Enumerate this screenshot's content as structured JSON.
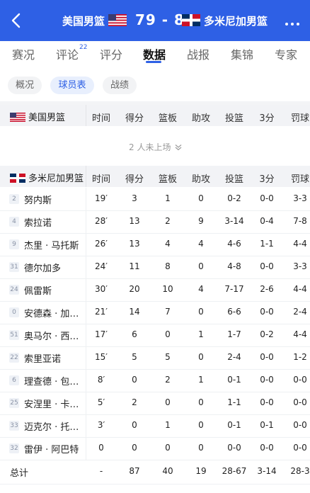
{
  "header": {
    "home_team": "美国男篮",
    "score": "79 - 87",
    "away_team": "多米尼加男篮"
  },
  "tabs": [
    {
      "label": "赛况"
    },
    {
      "label": "评论",
      "badge": "22"
    },
    {
      "label": "评分"
    },
    {
      "label": "数据",
      "active": true
    },
    {
      "label": "战报"
    },
    {
      "label": "集锦"
    },
    {
      "label": "专家"
    }
  ],
  "subtabs": [
    {
      "label": "概况"
    },
    {
      "label": "球员表",
      "active": true
    },
    {
      "label": "战绩"
    }
  ],
  "columns": [
    "时间",
    "得分",
    "篮板",
    "助攻",
    "投篮",
    "3分",
    "罚球"
  ],
  "home_section": {
    "team": "美国男篮",
    "bench_text": "2 人未上场"
  },
  "away_section": {
    "team": "多米尼加男篮",
    "players": [
      {
        "num": "2",
        "name": "努内斯",
        "stats": [
          "19′",
          "3",
          "1",
          "0",
          "0-2",
          "0-0",
          "3-3"
        ]
      },
      {
        "num": "4",
        "name": "索拉诺",
        "stats": [
          "28′",
          "13",
          "2",
          "9",
          "3-14",
          "0-4",
          "7-8"
        ]
      },
      {
        "num": "9",
        "name": "杰里 · 马托斯",
        "stats": [
          "26′",
          "13",
          "4",
          "4",
          "4-6",
          "1-1",
          "4-4"
        ]
      },
      {
        "num": "31",
        "name": "德尔加多",
        "stats": [
          "24′",
          "11",
          "8",
          "0",
          "4-8",
          "0-0",
          "3-3"
        ]
      },
      {
        "num": "24",
        "name": "佩雷斯",
        "stats": [
          "30′",
          "20",
          "10",
          "4",
          "7-17",
          "2-6",
          "4-4"
        ]
      },
      {
        "num": "0",
        "name": "安德森 · 加…",
        "stats": [
          "21′",
          "14",
          "7",
          "0",
          "6-6",
          "0-0",
          "2-4"
        ]
      },
      {
        "num": "51",
        "name": "奥马尔 · 西…",
        "stats": [
          "17′",
          "6",
          "0",
          "1",
          "1-7",
          "0-2",
          "4-4"
        ]
      },
      {
        "num": "22",
        "name": "索里亚诺",
        "stats": [
          "15′",
          "5",
          "5",
          "0",
          "2-4",
          "0-0",
          "1-2"
        ]
      },
      {
        "num": "6",
        "name": "理查德 · 包…",
        "stats": [
          "8′",
          "0",
          "2",
          "1",
          "0-1",
          "0-0",
          "0-0"
        ]
      },
      {
        "num": "25",
        "name": "安涅里 · 卡…",
        "stats": [
          "5′",
          "2",
          "0",
          "0",
          "1-1",
          "0-0",
          "0-0"
        ]
      },
      {
        "num": "33",
        "name": "迈克尔 · 托…",
        "stats": [
          "3′",
          "0",
          "1",
          "0",
          "0-1",
          "0-1",
          "0-0"
        ]
      },
      {
        "num": "32",
        "name": "雷伊 · 阿巴特",
        "stats": [
          "0",
          "0",
          "0",
          "0",
          "0-0",
          "0-0",
          "0-0"
        ]
      }
    ],
    "total": {
      "label": "总计",
      "stats": [
        "-",
        "87",
        "40",
        "19",
        "28-67",
        "3-14",
        "28-3"
      ]
    }
  },
  "colors": {
    "brand": "#2e60e5"
  }
}
